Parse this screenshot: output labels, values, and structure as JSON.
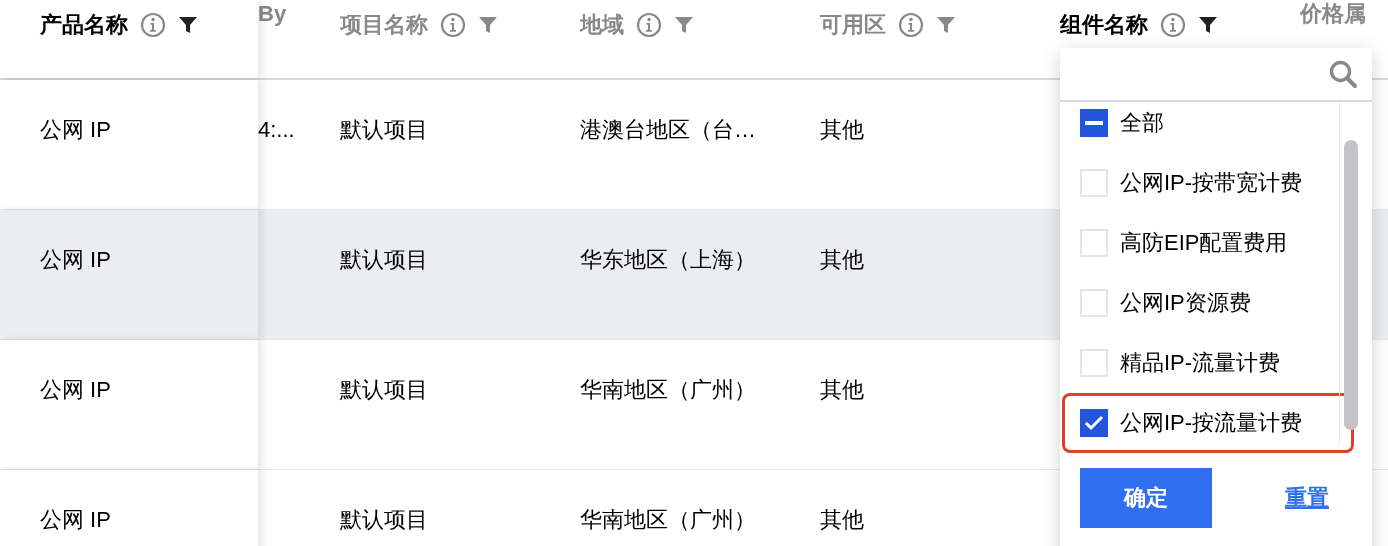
{
  "table": {
    "columns": [
      {
        "label": "产品名称",
        "active": true,
        "icons": true
      },
      {
        "label": "By",
        "active": false,
        "icons": false
      },
      {
        "label": "项目名称",
        "active": false,
        "icons": true
      },
      {
        "label": "地域",
        "active": false,
        "icons": true
      },
      {
        "label": "可用区",
        "active": false,
        "icons": true
      },
      {
        "label": "组件名称",
        "active": true,
        "icons": true
      },
      {
        "label": "价格属",
        "active": false,
        "icons": false
      }
    ],
    "rows": [
      {
        "highlighted": false,
        "product": "公网 IP",
        "column_2": "4:...",
        "project": "默认项目",
        "region": "港澳台地区（台…",
        "zone": "其他"
      },
      {
        "highlighted": true,
        "product": "公网 IP",
        "project": "默认项目",
        "region": "华东地区（上海）",
        "zone": "其他"
      },
      {
        "highlighted": false,
        "product": "公网 IP",
        "project": "默认项目",
        "region": "华南地区（广州）",
        "zone": "其他"
      },
      {
        "highlighted": false,
        "product": "公网 IP",
        "project": "默认项目",
        "region": "华南地区（广州）",
        "zone": "其他"
      }
    ]
  },
  "filter_dropdown": {
    "items": [
      {
        "kind": "select-all",
        "label": "全部",
        "indeterminate": true,
        "highlighted": false
      },
      {
        "kind": "option",
        "label": "公网IP-按带宽计费",
        "checked": false,
        "highlighted": false
      },
      {
        "kind": "option",
        "label": "高防EIP配置费用",
        "checked": false,
        "highlighted": false
      },
      {
        "kind": "option",
        "label": "公网IP资源费",
        "checked": false,
        "highlighted": false
      },
      {
        "kind": "option",
        "label": "精品IP-流量计费",
        "checked": false,
        "highlighted": false
      },
      {
        "kind": "option",
        "label": "公网IP-按流量计费",
        "checked": true,
        "highlighted": true
      }
    ],
    "buttons": {
      "confirm": "确定",
      "reset": "重置"
    }
  }
}
